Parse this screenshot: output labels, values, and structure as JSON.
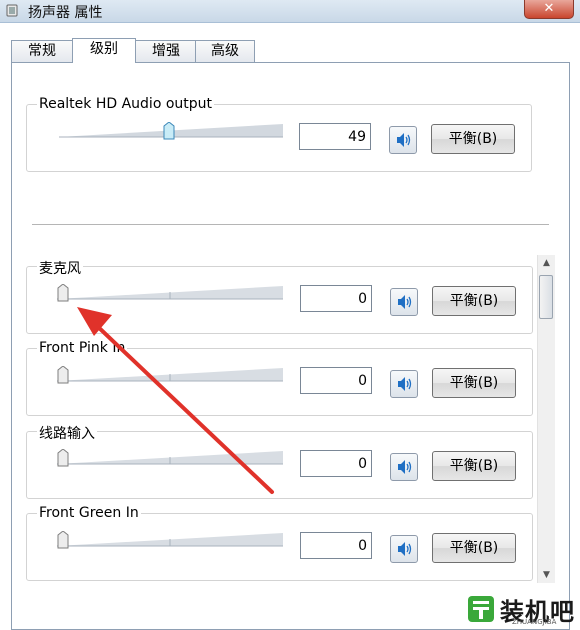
{
  "window": {
    "title": "扬声器 属性",
    "close_label": "✕"
  },
  "tabs": [
    {
      "label": "常规",
      "active": false
    },
    {
      "label": "级别",
      "active": true
    },
    {
      "label": "增强",
      "active": false
    },
    {
      "label": "高级",
      "active": false
    }
  ],
  "output": {
    "label": "Realtek HD Audio output",
    "value": "49",
    "level": 0.49,
    "balance_label": "平衡(B)"
  },
  "inputs": [
    {
      "label": "麦克风",
      "value": "0",
      "level": 0,
      "balance_label": "平衡(B)"
    },
    {
      "label": "Front Pink In",
      "value": "0",
      "level": 0,
      "balance_label": "平衡(B)"
    },
    {
      "label": "线路输入",
      "value": "0",
      "level": 0,
      "balance_label": "平衡(B)"
    },
    {
      "label": "Front Green In",
      "value": "0",
      "level": 0,
      "balance_label": "平衡(B)"
    }
  ],
  "colors": {
    "accent": "#1f6fc4",
    "arrow": "#e0322a"
  },
  "icons": {
    "speaker": "speaker-icon",
    "window": "window-icon",
    "close": "close-icon"
  },
  "watermark": {
    "text": "装机吧",
    "sub": "ZHUANGJIBA"
  }
}
